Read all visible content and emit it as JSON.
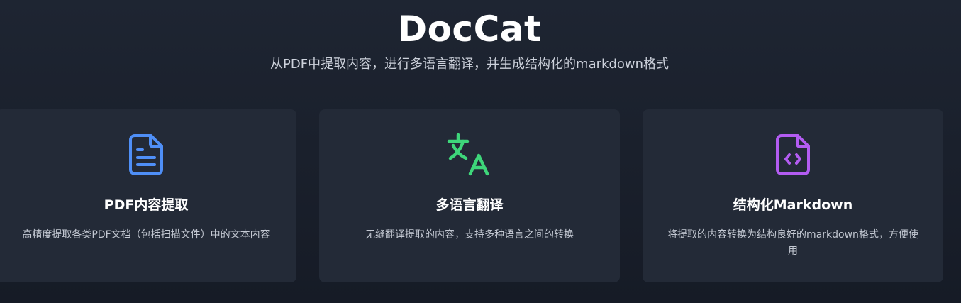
{
  "header": {
    "title": "DocCat",
    "subtitle": "从PDF中提取内容，进行多语言翻译，并生成结构化的markdown格式"
  },
  "features": [
    {
      "title": "PDF内容提取",
      "description": "高精度提取各类PDF文档（包括扫描文件）中的文本内容",
      "icon": "document-text-icon",
      "color": "#4f8ff7"
    },
    {
      "title": "多语言翻译",
      "description": "无缝翻译提取的内容，支持多种语言之间的转换",
      "icon": "translate-icon",
      "color": "#3ed67a"
    },
    {
      "title": "结构化Markdown",
      "description": "将提取的内容转换为结构良好的markdown格式，方便使用",
      "icon": "file-code-icon",
      "color": "#b35cf2"
    }
  ]
}
